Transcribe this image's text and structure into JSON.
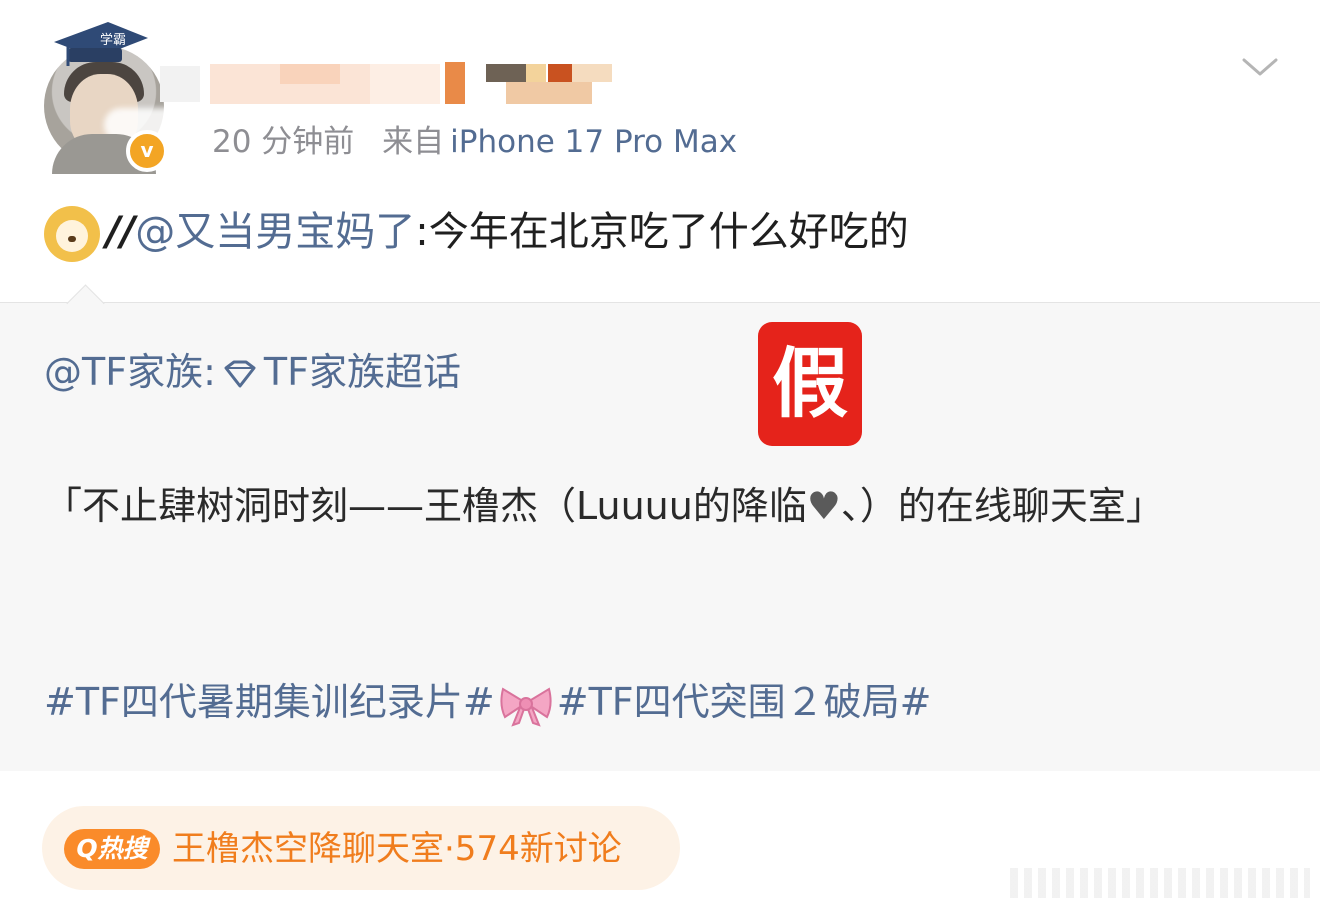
{
  "header": {
    "cap_text": "学霸",
    "vip_badge": "v",
    "time_ago": "20 分钟前",
    "source_prefix": "来自",
    "source_device": "iPhone 17 Pro Max"
  },
  "post": {
    "emoji": "doge-emoji",
    "repost_prefix": "//",
    "mention": "@又当男宝妈了",
    "colon": ":",
    "text": "今年在北京吃了什么好吃的"
  },
  "quoted": {
    "author": "@TF家族:",
    "supertopic": "TF家族超话",
    "fake_stamp": "假",
    "body_part1": "「不止肆树洞时刻——王橹杰（Luuuu的降临",
    "body_heart": "♥",
    "body_part2": "、）的在线聊天室」",
    "tag1": "#TF四代暑期集训纪录片#",
    "tag2": "#TF四代突围２破局#"
  },
  "hot_search": {
    "badge": "Q热搜",
    "text": "王橹杰空降聊天室·574新讨论"
  },
  "colors": {
    "link": "#536c92",
    "hot_orange": "#f07d1d",
    "fake_red": "#e5231b",
    "vip_orange": "#f3a524"
  }
}
